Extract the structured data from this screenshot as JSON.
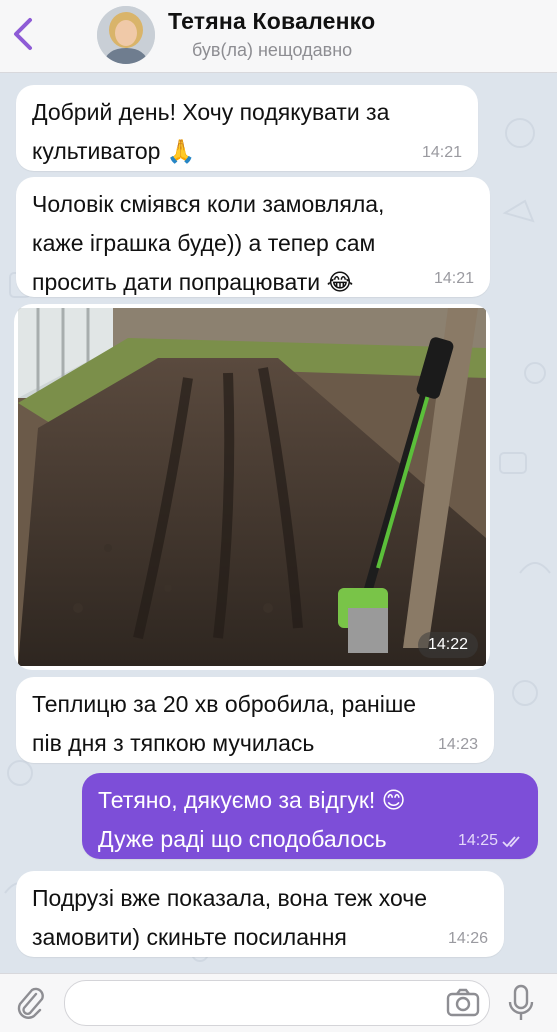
{
  "header": {
    "contact_name": "Тетяна Коваленко",
    "status": "був(ла) нещодавно"
  },
  "messages": [
    {
      "direction": "in",
      "text": "Добрий день! Хочу подякувати за\nкультиватор 🙏",
      "time": "14:21"
    },
    {
      "direction": "in",
      "text": "Чоловік сміявся коли замовляла,\nкаже іграшка буде)) а тепер сам\nпросить дати попрацювати 😂",
      "time": "14:21"
    },
    {
      "direction": "in",
      "type": "photo",
      "time": "14:22",
      "icon": "photo-garden-bed-cultivator"
    },
    {
      "direction": "in",
      "text": "Теплицю за 20 хв обробила, раніше\nпів дня з тяпкою мучилась",
      "time": "14:23"
    },
    {
      "direction": "out",
      "text": "Тетяно, дякуємо за відгук! 😊\nДуже раді що сподобалось",
      "time": "14:25",
      "read": true
    },
    {
      "direction": "in",
      "text": "Подрузі вже показала, вона теж хоче\nзамовити) скиньте посилання",
      "time": "14:26"
    }
  ],
  "input": {
    "placeholder": "",
    "value": ""
  },
  "colors": {
    "accent": "#7d4ed8",
    "incoming": "#ffffff",
    "back_arrow": "#8e5bd6"
  }
}
